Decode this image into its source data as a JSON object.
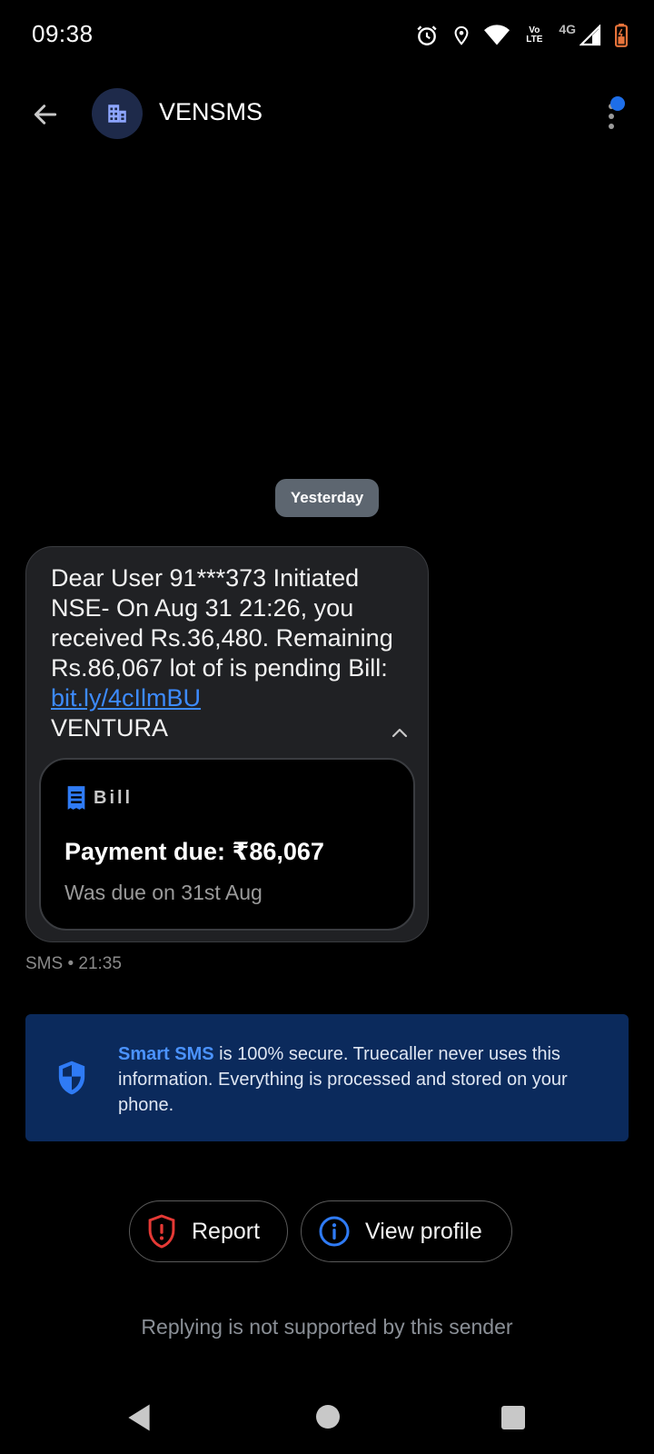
{
  "status_bar": {
    "time": "09:38",
    "lte_top": "Vo",
    "lte_bottom": "LTE",
    "network": "4G",
    "icons": [
      "alarm-icon",
      "location-icon",
      "wifi-icon",
      "volte-icon",
      "signal-icon",
      "battery-icon"
    ]
  },
  "header": {
    "sender_name": "VENSMS",
    "avatar_icon": "building-icon",
    "back_icon": "arrow-left-icon",
    "menu_icon": "more-vertical-icon"
  },
  "conversation": {
    "date_chip": "Yesterday",
    "message": {
      "text_before_link": "Dear User 91***373 Initiated NSE- On Aug 31 21:26, you received Rs.36,480. Remaining Rs.86,067 lot of is pending Bill: ",
      "link_text": "bit.ly/4cIlmBU",
      "text_after_link": "VENTURA",
      "meta": "SMS • 21:35"
    },
    "bill_card": {
      "label": "Bill",
      "amount_text": "Payment due: ₹86,067",
      "due_text": "Was due on 31st Aug"
    }
  },
  "info_banner": {
    "highlight": "Smart SMS",
    "text": " is 100% secure. Truecaller never uses this information. Everything is processed and stored on your phone."
  },
  "actions": {
    "report_label": "Report",
    "view_profile_label": "View profile"
  },
  "footer": {
    "reply_note": "Replying is not supported by this sender"
  },
  "colors": {
    "background": "#000000",
    "bubble": "#202124",
    "accent_blue": "#1e6ee8",
    "link_blue": "#3d8bff",
    "banner_bg": "#0b2a5c",
    "report_red": "#e53935"
  }
}
